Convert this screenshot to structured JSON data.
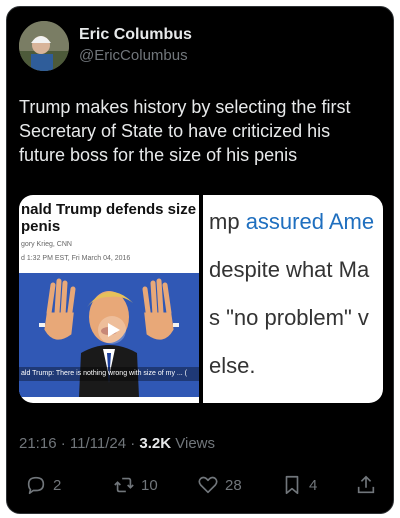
{
  "author": {
    "display_name": "Eric Columbus",
    "handle": "@EricColumbus"
  },
  "tweet": {
    "text": "Trump makes history by selecting the first Secretary of State to have criticized his future boss for the size of his penis"
  },
  "media": {
    "left": {
      "headline_line1": "nald Trump defends size o",
      "headline_line2": "penis",
      "byline": "gory Krieg, CNN",
      "date": "d 1:32 PM EST, Fri March 04, 2016",
      "caption": "ald Trump: There is nothing wrong with size of my ... ("
    },
    "right": {
      "line1_prefix": "mp ",
      "line1_link": "assured Ame",
      "line2": "despite what Ma",
      "line3": "s \"no problem\" v",
      "line4": "else."
    }
  },
  "meta": {
    "time": "21:16",
    "date": "11/11/24",
    "separator": "·",
    "views_count": "3.2K",
    "views_label": "Views"
  },
  "actions": {
    "replies": "2",
    "reposts": "10",
    "likes": "28",
    "bookmarks": "4"
  },
  "colors": {
    "background": "#000000",
    "text_primary": "#e7e9ea",
    "text_secondary": "#71767b",
    "link": "#1f6fbf"
  }
}
